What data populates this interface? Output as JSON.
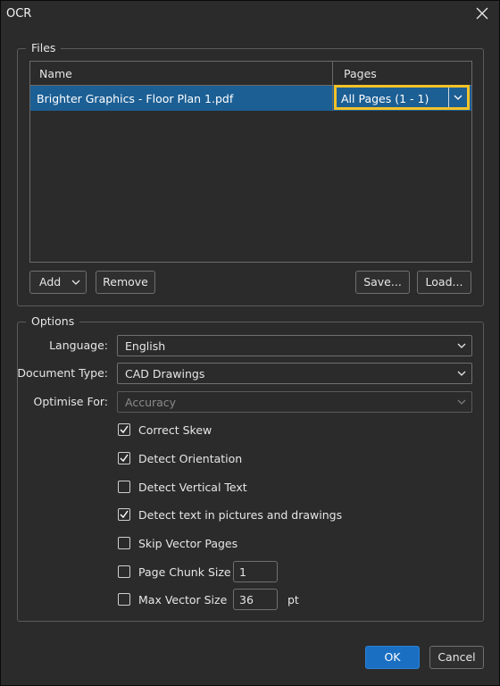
{
  "window": {
    "title": "OCR"
  },
  "files": {
    "legend": "Files",
    "columns": [
      "Name",
      "Pages"
    ],
    "rows": [
      {
        "name": "Brighter Graphics - Floor Plan 1.pdf",
        "pages": "All Pages (1 - 1)"
      }
    ],
    "buttons": {
      "add": "Add",
      "remove": "Remove",
      "save": "Save...",
      "load": "Load..."
    }
  },
  "options": {
    "legend": "Options",
    "language": {
      "label": "Language:",
      "value": "English"
    },
    "document_type": {
      "label": "Document Type:",
      "value": "CAD Drawings"
    },
    "optimise_for": {
      "label": "Optimise For:",
      "value": "Accuracy",
      "disabled": true
    },
    "checkboxes": [
      {
        "label": "Correct Skew",
        "checked": true
      },
      {
        "label": "Detect Orientation",
        "checked": true
      },
      {
        "label": "Detect Vertical Text",
        "checked": false
      },
      {
        "label": "Detect text in pictures and drawings",
        "checked": true
      },
      {
        "label": "Skip Vector Pages",
        "checked": false
      },
      {
        "label": "Page Chunk Size",
        "checked": false,
        "value": "1"
      },
      {
        "label": "Max Vector Size",
        "checked": false,
        "value": "36",
        "unit": "pt"
      }
    ]
  },
  "footer": {
    "ok": "OK",
    "cancel": "Cancel"
  },
  "colors": {
    "selection": "#1c5f94",
    "highlight": "#f2c22a",
    "ok_button": "#1a6fc2"
  }
}
